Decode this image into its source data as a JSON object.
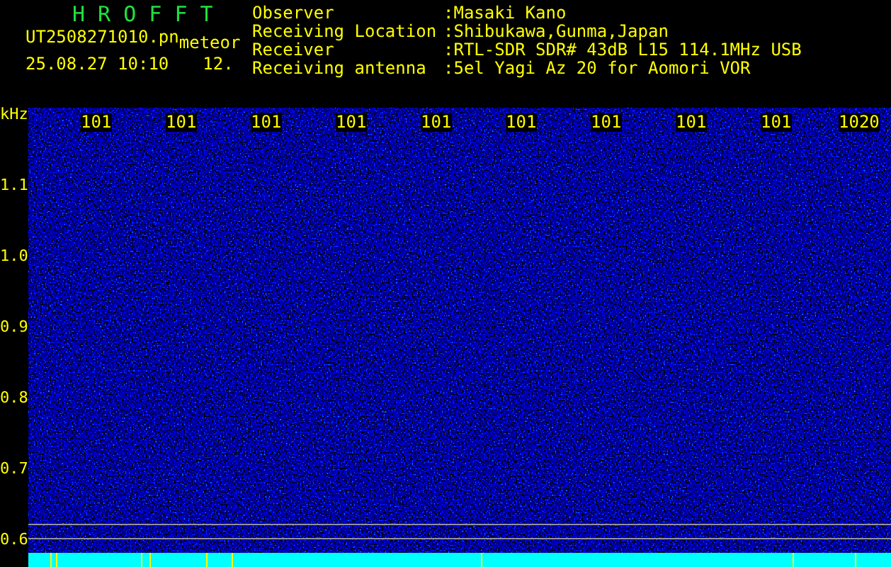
{
  "header": {
    "title": "H R O F F T",
    "filename": "UT2508271010.pn",
    "tag": "meteor",
    "datetime": "25.08.27 10:10",
    "value": "12.",
    "fields": [
      {
        "label": "Observer",
        "value": ":Masaki Kano"
      },
      {
        "label": "Receiving Location",
        "value": ":Shibukawa,Gunma,Japan"
      },
      {
        "label": "Receiver",
        "value": ":RTL-SDR SDR# 43dB L15 114.1MHz USB"
      },
      {
        "label": "Receiving antenna",
        "value": ":5el Yagi Az 20 for Aomori VOR"
      }
    ]
  },
  "plot": {
    "y_unit": "kHz",
    "y_labels": [
      "1.1",
      "1.0",
      "0.9",
      "0.8",
      "0.7",
      "0.6"
    ],
    "x_labels": [
      "101",
      "101",
      "101",
      "101",
      "101",
      "101",
      "101",
      "101",
      "101",
      "1020"
    ]
  }
}
